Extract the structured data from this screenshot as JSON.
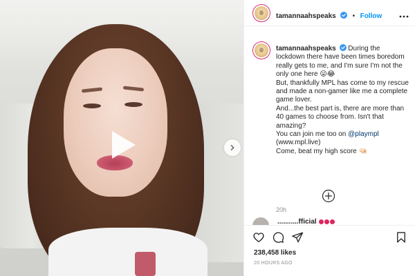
{
  "post": {
    "username": "tamannaahspeaks",
    "dot": "•",
    "follow_label": "Follow",
    "caption": {
      "username": "tamannaahspeaks",
      "line1": "During the lockdown there have been times boredom really gets to me, and I'm sure I'm not the only one here 😛😂",
      "line2": "But, thankfully MPL has come to my rescue and made a non-gamer like me a complete game lover.",
      "line3": "And...the best part is, there are more than 40 games to choose from. Isn't that amazing?",
      "line4_prefix": "You can join me too on ",
      "line4_mention": "@plaympl",
      "line5": "(www.mpl.live)",
      "line6": "Come, beat my high score 🤜🏻"
    },
    "caption_time": "20h",
    "peek_commenter": "...........fficial",
    "likes": "238,458 likes",
    "posted_ago": "20 HOURS AGO"
  },
  "icons": {
    "verified": "verified-badge-icon",
    "more": "more-options-icon",
    "play": "play-icon",
    "next": "chevron-right-icon",
    "load_more": "plus-circle-icon",
    "like": "heart-icon",
    "comment": "comment-icon",
    "share": "paper-plane-icon",
    "save": "bookmark-icon"
  },
  "colors": {
    "accent": "#0095f6",
    "verified": "#3897f0",
    "text": "#262626",
    "muted": "#8e8e8e",
    "avatar_ring": "#d62976"
  }
}
